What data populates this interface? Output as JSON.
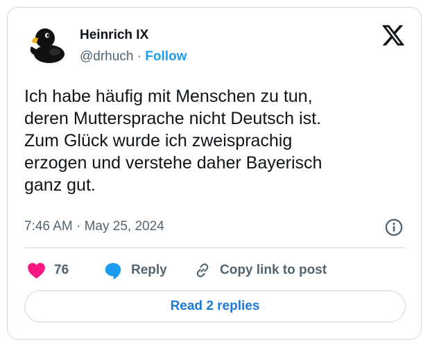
{
  "author": {
    "name": "Heinrich IX",
    "handle": "@drhuch",
    "separator": "·",
    "follow_label": "Follow"
  },
  "tweet": {
    "text": "Ich habe häufig mit Menschen zu tun,\nderen Muttersprache nicht Deutsch ist.\nZum Glück wurde ich zweisprachig\nerzogen und verstehe daher Bayerisch\nganz gut.",
    "timestamp": "7:46 AM · May 25, 2024"
  },
  "actions": {
    "like_count": "76",
    "reply_label": "Reply",
    "copy_link_label": "Copy link to post"
  },
  "read_replies_label": "Read 2 replies",
  "colors": {
    "accent": "#1d9bf0",
    "like": "#f91880",
    "reply_icon": "#1d9bf0",
    "text_primary": "#0f1419",
    "text_secondary": "#536471",
    "border": "#cfd9de"
  },
  "icons": {
    "avatar": "rubber-duck-icon",
    "brand": "x-logo-icon",
    "info": "info-icon",
    "like": "heart-icon",
    "reply": "speech-bubble-icon",
    "copy": "link-icon"
  }
}
